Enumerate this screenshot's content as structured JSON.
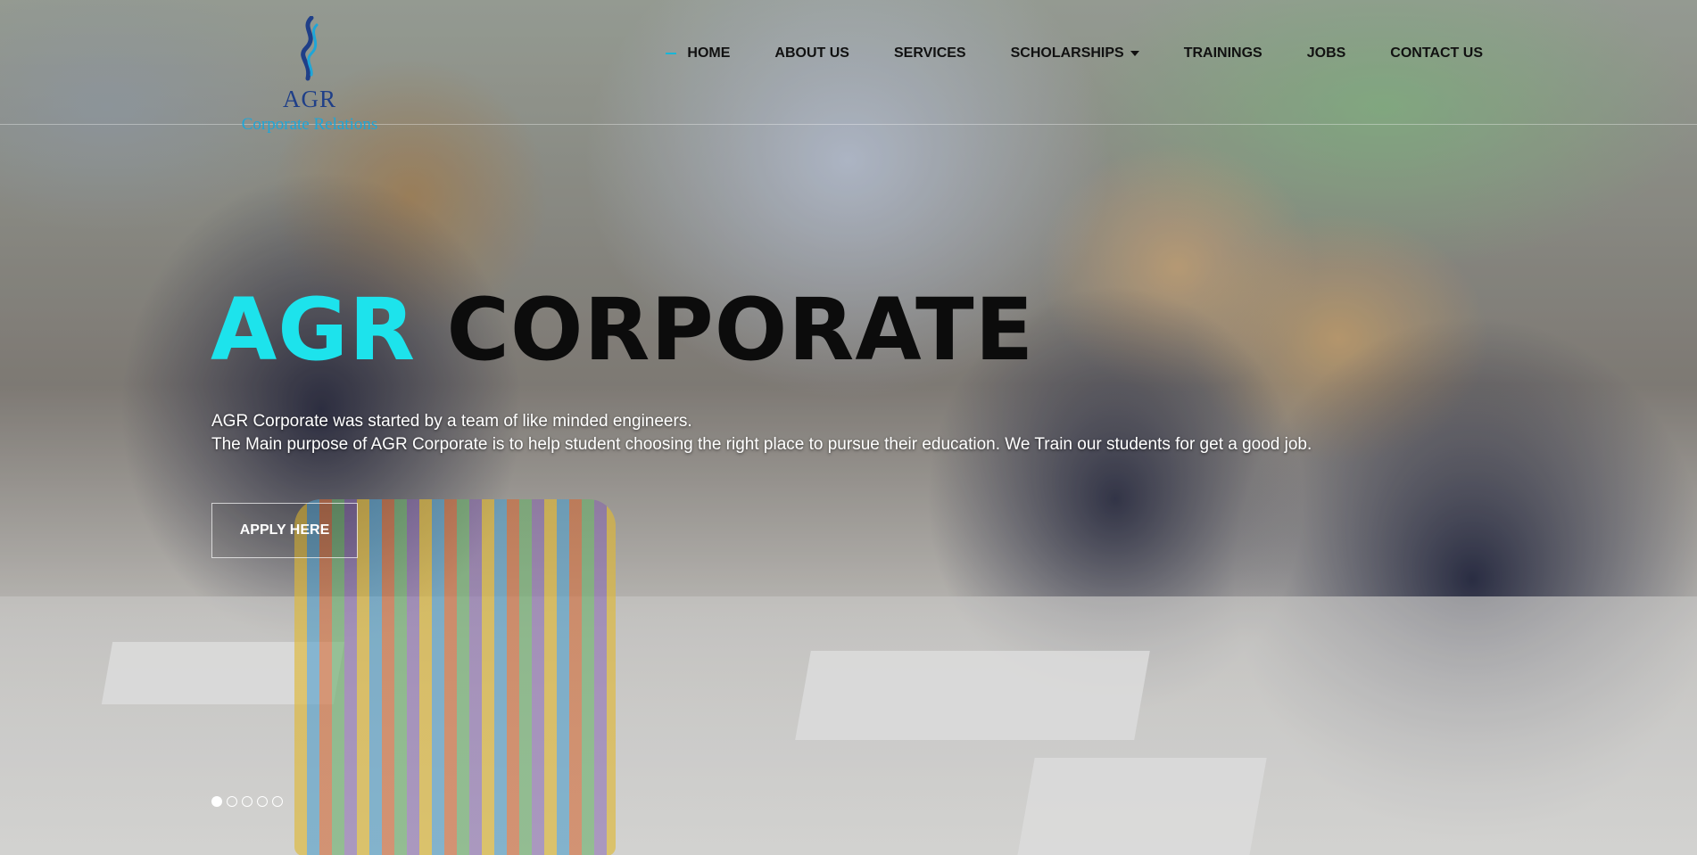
{
  "brand": {
    "name": "AGR",
    "tagline": "Corporate Relations",
    "colors": {
      "name": "#1f3f88",
      "tagline": "#1ea6d8"
    }
  },
  "nav": {
    "items": [
      {
        "label": "HOME",
        "active": true
      },
      {
        "label": "ABOUT US"
      },
      {
        "label": "SERVICES"
      },
      {
        "label": "SCHOLARSHIPS",
        "dropdown": true
      },
      {
        "label": "TRAININGS"
      },
      {
        "label": "JOBS"
      },
      {
        "label": "CONTACT US"
      }
    ],
    "active_color": "#18b6d8"
  },
  "hero": {
    "title_accent": "AGR",
    "title_rest": "CORPORATE",
    "accent_color": "#1de3ec",
    "lines": [
      "AGR Corporate was started by a team of like minded engineers.",
      "The Main purpose of AGR Corporate is to help student choosing the right place to pursue their education. We Train our students for get a good job."
    ],
    "cta_label": "APPLY HERE"
  },
  "slider": {
    "total": 5,
    "active": 1
  }
}
